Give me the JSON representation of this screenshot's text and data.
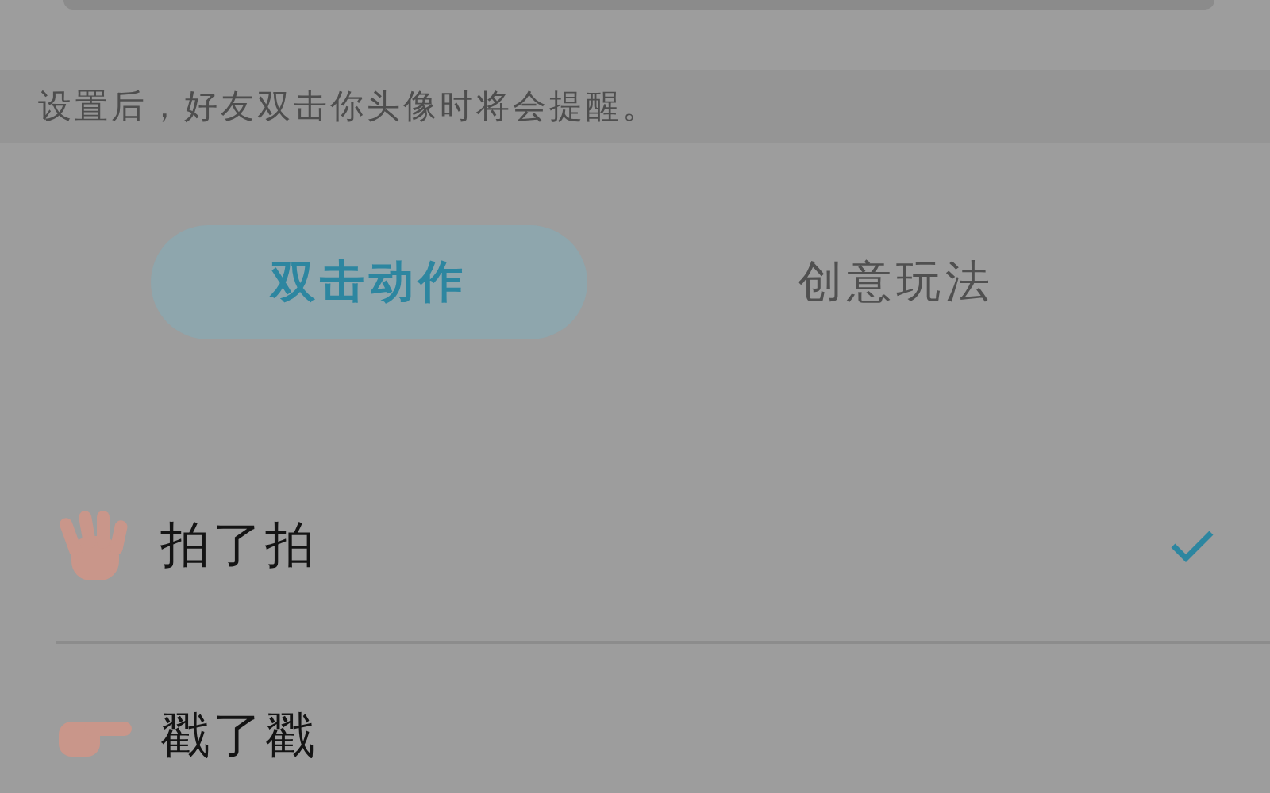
{
  "hint": "设置后，好友双击你头像时将会提醒。",
  "tabs": [
    {
      "label": "双击动作",
      "selected": true
    },
    {
      "label": "创意玩法",
      "selected": false
    }
  ],
  "actions": [
    {
      "kind": "wave",
      "label": "拍了拍",
      "selected": true
    },
    {
      "kind": "poke",
      "label": "戳了戳",
      "selected": false
    }
  ]
}
